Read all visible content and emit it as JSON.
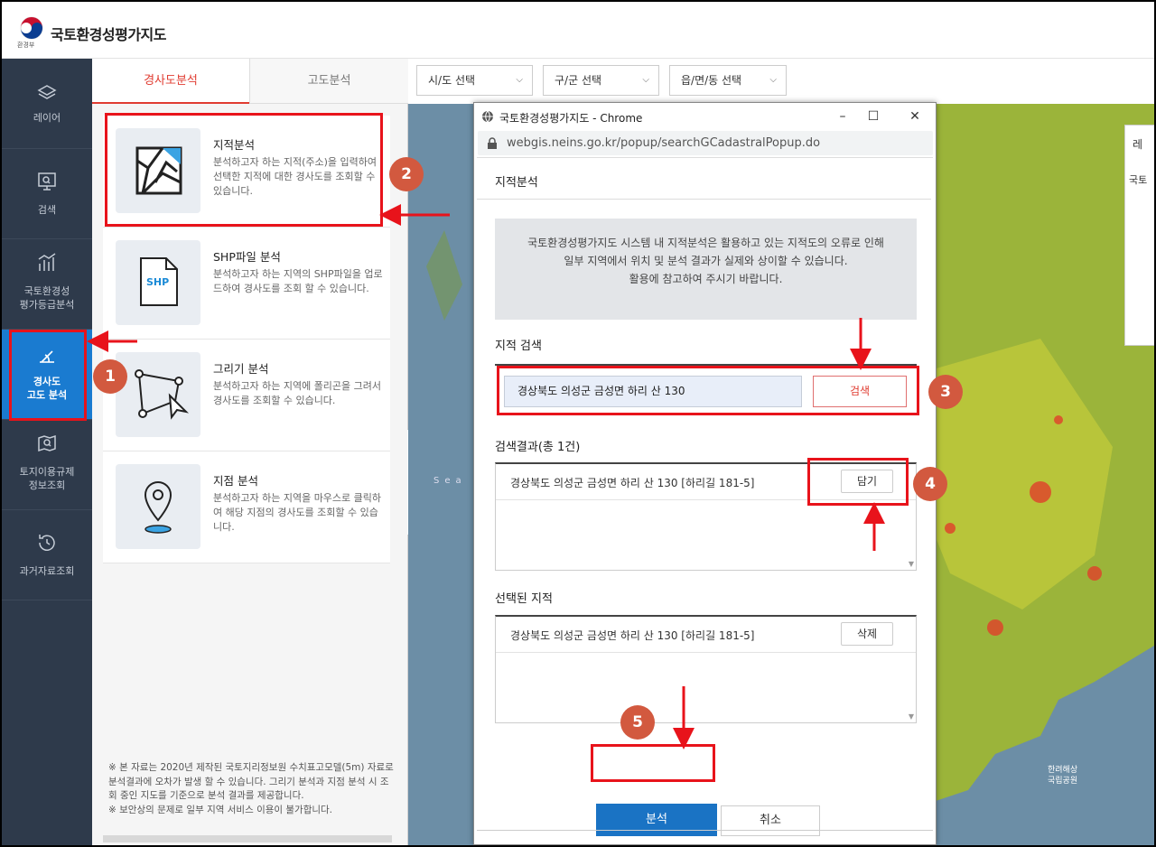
{
  "app": {
    "title": "국토환경성평가지도",
    "logo_sub": "환경부"
  },
  "nav": {
    "items": [
      {
        "label": "레이어",
        "icon": "layers-icon"
      },
      {
        "label": "검색",
        "icon": "search-monitor-icon"
      },
      {
        "label": "국토환경성\n평가등급분석",
        "icon": "bar-chart-icon"
      },
      {
        "label": "경사도\n고도 분석",
        "icon": "slope-icon",
        "active": true
      },
      {
        "label": "토지이용규제\n정보조회",
        "icon": "map-search-icon"
      },
      {
        "label": "과거자료조회",
        "icon": "history-icon"
      }
    ]
  },
  "panel": {
    "tabs": [
      "경사도분석",
      "고도분석"
    ],
    "cards": [
      {
        "title": "지적분석",
        "desc": "분석하고자 하는 지적(주소)을 입력하여 선택한 지적에 대한 경사도를 조회할 수 있습니다.",
        "icon": "cadastral-map-icon"
      },
      {
        "title": "SHP파일 분석",
        "desc": "분석하고자 하는 지역의 SHP파일을 업로드하여 경사도를 조회 할 수 있습니다.",
        "icon": "shp-file-icon",
        "icon_text": "SHP"
      },
      {
        "title": "그리기 분석",
        "desc": "분석하고자 하는 지역에 폴리곤을 그려서 경사도를 조회할 수 있습니다.",
        "icon": "polygon-draw-icon"
      },
      {
        "title": "지점 분석",
        "desc": "분석하고자 하는 지역을 마우스로 클릭하여 해당 지점의 경사도를 조회할 수 있습니다.",
        "icon": "location-pin-icon"
      }
    ],
    "note": "※ 본 자료는 2020년 제작된 국토지리정보원 수치표고모델(5m) 자료로 분석결과에 오차가 발생 할 수 있습니다. 그리기 분석과 지점 분석 시 조회 중인 지도를 기준으로 분석 결과를 제공합니다.\n※ 보안상의 문제로 일부 지역 서비스 이용이 불가합니다."
  },
  "map": {
    "selects": [
      "시/도 선택",
      "구/군 선택",
      "읍/면/동 선택"
    ],
    "right_box_title": "레",
    "right_box_item": "국토",
    "sea_label": "Sea",
    "park_label": "한려해상\n국립공원"
  },
  "popup": {
    "window_title": "국토환경성평가지도 - Chrome",
    "url": "webgis.neins.go.kr/popup/searchGCadastralPopup.do",
    "heading": "지적분석",
    "notice": "국토환경성평가지도 시스템 내 지적분석은 활용하고 있는 지적도의 오류로 인해\n일부 지역에서 위치 및 분석 결과가 실제와 상이할 수 있습니다.\n활용에 참고하여 주시기 바랍니다.",
    "search_label": "지적 검색",
    "search_value": "경상북도 의성군 금성면 하리 산 130",
    "search_button": "검색",
    "results_label": "검색결과(총 1건)",
    "result_item": "경상북도 의성군 금성면 하리 산 130 [하리길 181-5]",
    "add_button": "담기",
    "selected_label": "선택된 지적",
    "selected_item": "경상북도 의성군 금성면 하리 산 130 [하리길 181-5]",
    "delete_button": "삭제",
    "analyze_button": "분석",
    "cancel_button": "취소"
  },
  "annotations": [
    "1",
    "2",
    "3",
    "4",
    "5"
  ],
  "colors": {
    "nav_bg": "#2e3a4b",
    "nav_active": "#1a7bd0",
    "accent_red": "#e03c31",
    "highlight": "#e8131b",
    "badge": "#d2593f",
    "primary_button": "#1a73c4"
  }
}
